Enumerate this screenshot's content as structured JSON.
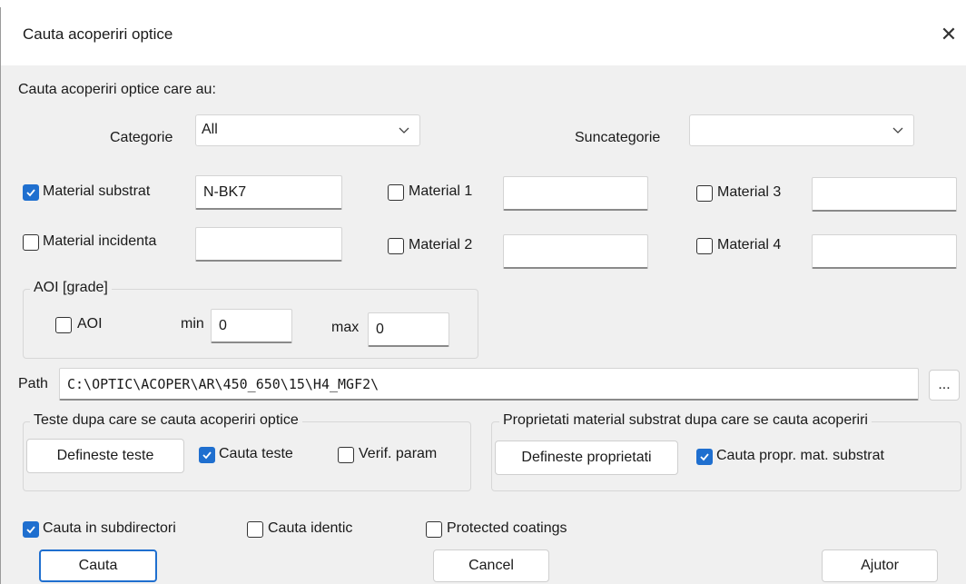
{
  "window": {
    "title": "Cauta acoperiri optice",
    "close_label": "✕"
  },
  "heading": "Cauta acoperiri optice care au:",
  "categorie": {
    "label": "Categorie",
    "value": "All"
  },
  "suncategorie": {
    "label": "Suncategorie",
    "value": ""
  },
  "materials": {
    "substrat": {
      "label": "Material substrat",
      "value": "N-BK7",
      "checked": true
    },
    "incidenta": {
      "label": "Material incidenta",
      "value": "",
      "checked": false
    },
    "m1": {
      "label": "Material 1",
      "value": "",
      "checked": false
    },
    "m2": {
      "label": "Material 2",
      "value": "",
      "checked": false
    },
    "m3": {
      "label": "Material 3",
      "value": "",
      "checked": false
    },
    "m4": {
      "label": "Material 4",
      "value": "",
      "checked": false
    }
  },
  "aoi": {
    "group_title": "AOI [grade]",
    "label": "AOI",
    "checked": false,
    "min_label": "min",
    "min_value": "0",
    "max_label": "max",
    "max_value": "0"
  },
  "path": {
    "label": "Path",
    "value": "C:\\OPTIC\\ACOPER\\AR\\450_650\\15\\H4_MGF2\\",
    "browse_label": "..."
  },
  "teste": {
    "group_title": "Teste dupa care se cauta acoperiri optice",
    "define_button": "Defineste teste",
    "cauta_teste": "Cauta teste",
    "cauta_teste_checked": true,
    "verif_param": "Verif. param",
    "verif_param_checked": false
  },
  "proprietati": {
    "group_title": "Proprietati material substrat dupa care se cauta acoperiri",
    "define_button": "Defineste proprietati",
    "cauta_propr": "Cauta propr. mat. substrat",
    "cauta_propr_checked": true
  },
  "options": {
    "subdirectori": {
      "label": "Cauta in subdirectori",
      "checked": true
    },
    "identic": {
      "label": "Cauta identic",
      "checked": false
    },
    "protected": {
      "label": "Protected coatings",
      "checked": false
    }
  },
  "buttons": {
    "cauta": "Cauta",
    "cancel": "Cancel",
    "ajutor": "Ajutor"
  },
  "colors": {
    "accent": "#1f6fcf",
    "background": "#f0f0f0"
  }
}
